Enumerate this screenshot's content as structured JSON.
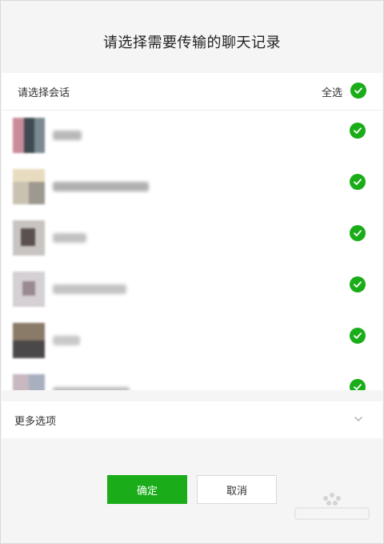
{
  "dialog": {
    "title": "请选择需要传输的聊天记录"
  },
  "panel": {
    "header_label": "请选择会话",
    "select_all_label": "全选",
    "select_all_checked": true,
    "conversations": [
      {
        "checked": true
      },
      {
        "checked": true
      },
      {
        "checked": true
      },
      {
        "checked": true
      },
      {
        "checked": true
      },
      {
        "checked": true
      }
    ]
  },
  "more_options": {
    "label": "更多选项"
  },
  "buttons": {
    "confirm": "确定",
    "cancel": "取消"
  },
  "colors": {
    "accent": "#1aad19",
    "background": "#f5f5f5"
  },
  "icons": {
    "check": "check-circle-icon",
    "expand": "chevron-down-icon"
  }
}
